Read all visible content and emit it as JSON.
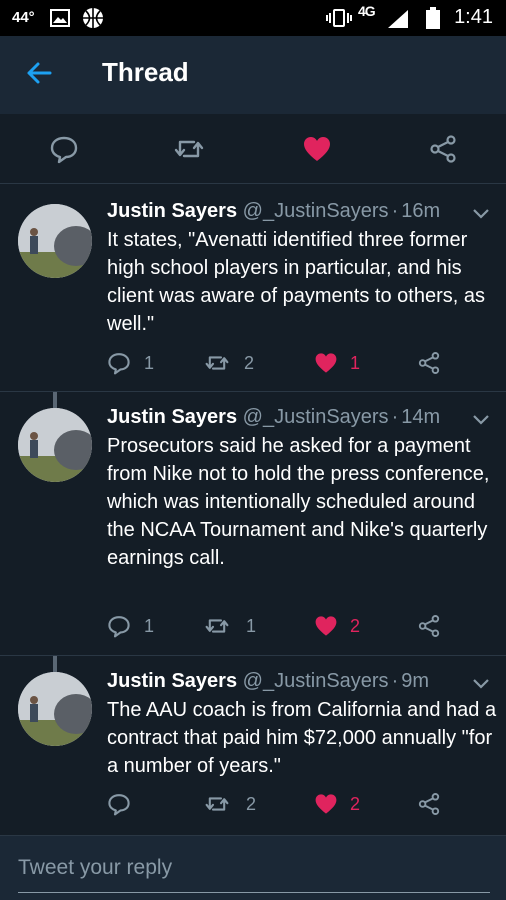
{
  "status_bar": {
    "temperature": "44°",
    "network": "4G",
    "time": "1:41"
  },
  "header": {
    "title": "Thread",
    "back_icon": "arrow-left-icon"
  },
  "main_actions": {
    "icons": [
      "reply-icon",
      "retweet-icon",
      "heart-icon",
      "share-icon"
    ],
    "liked": true
  },
  "colors": {
    "background": "#141d26",
    "bar": "#1b2836",
    "accent": "#1da1f2",
    "like": "#e0245e",
    "muted": "#8899a6"
  },
  "tweets": [
    {
      "name": "Justin Sayers",
      "handle": "@_JustinSayers",
      "separator": "·",
      "time": "16m",
      "text": "It states, \"Avenatti identified three former high school players in particular, and his client was aware of payments to others, as well.\"",
      "replies": "1",
      "retweets": "2",
      "likes": "1"
    },
    {
      "name": "Justin Sayers",
      "handle": "@_JustinSayers",
      "separator": "·",
      "time": "14m",
      "text": "Prosecutors said he asked for a payment from Nike not to hold the press conference, which was intentionally scheduled around the NCAA Tournament and Nike's quarterly earnings call.",
      "replies": "1",
      "retweets": "1",
      "likes": "2"
    },
    {
      "name": "Justin Sayers",
      "handle": "@_JustinSayers",
      "separator": "·",
      "time": "9m",
      "text": "The AAU coach is from California and had a contract that paid him $72,000 annually \"for a number of years.\"",
      "replies": "",
      "retweets": "2",
      "likes": "2"
    }
  ],
  "reply_box": {
    "placeholder": "Tweet your reply"
  }
}
